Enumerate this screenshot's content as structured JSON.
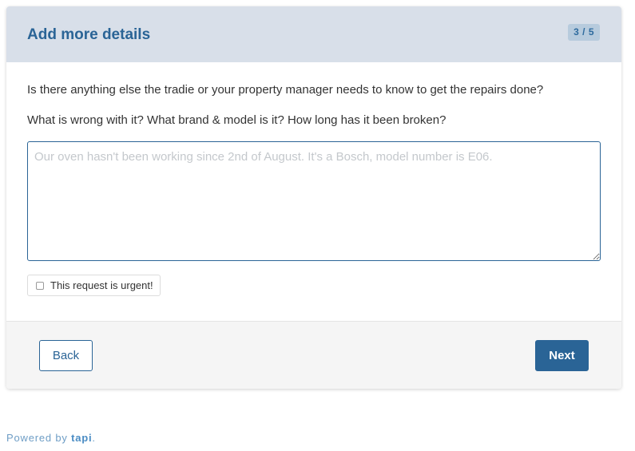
{
  "header": {
    "title": "Add more details",
    "step": "3 / 5"
  },
  "prompts": {
    "question_1": "Is there anything else the tradie or your property manager needs to know to get the repairs done?",
    "question_2": "What is wrong with it? What brand & model is it? How long has it been broken?"
  },
  "details": {
    "value": "",
    "placeholder": "Our oven hasn't been working since 2nd of August. It's a Bosch, model number is E06."
  },
  "urgent": {
    "label": "This request is urgent!",
    "checked": false
  },
  "footer": {
    "back_label": "Back",
    "next_label": "Next"
  },
  "powered_by": {
    "prefix": "Powered by",
    "brand": "tapi",
    "suffix": "."
  },
  "colors": {
    "accent": "#2a6496",
    "header_bg": "#d8dfe9",
    "badge_bg": "#b7cbdd",
    "footer_bg": "#f5f5f5"
  }
}
